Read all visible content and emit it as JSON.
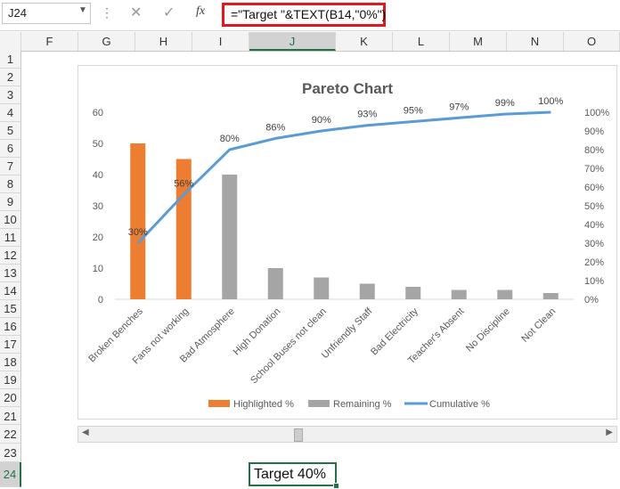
{
  "namebox": {
    "value": "J24"
  },
  "formula": {
    "value": "=\"Target \"&TEXT(B14,\"0%\")"
  },
  "icons": {
    "fx": "fx",
    "cancel": "✕",
    "enter": "✓",
    "dots": "⋮",
    "dropdown": "▼"
  },
  "columns": [
    "F",
    "G",
    "H",
    "I",
    "J",
    "K",
    "L",
    "M",
    "N",
    "O"
  ],
  "rows": [
    "1",
    "2",
    "3",
    "4",
    "5",
    "6",
    "7",
    "8",
    "9",
    "10",
    "11",
    "12",
    "13",
    "14",
    "15",
    "16",
    "17",
    "18",
    "19",
    "20",
    "21",
    "22",
    "23",
    "24"
  ],
  "selected": {
    "column": "J",
    "row": "24"
  },
  "active_cell": {
    "value": "Target 40%"
  },
  "chart_data": {
    "type": "bar",
    "title": "Pareto Chart",
    "categories": [
      "Broken Benches",
      "Fans not working",
      "Bad Atmosphere",
      "High Donation",
      "School Buses not clean",
      "Unfriendly Staff",
      "Bad Electricity",
      "Teacher's Absent",
      "No Discipline",
      "Not Clean"
    ],
    "series": [
      {
        "name": "Highlighted %",
        "kind": "bar",
        "color": "#ed7d31",
        "values": [
          50,
          45,
          0,
          0,
          0,
          0,
          0,
          0,
          0,
          0
        ]
      },
      {
        "name": "Remaining %",
        "kind": "bar",
        "color": "#a5a5a5",
        "values": [
          0,
          0,
          40,
          10,
          7,
          5,
          4,
          3,
          3,
          2
        ]
      },
      {
        "name": "Cumulative %",
        "kind": "line",
        "axis": "secondary",
        "color": "#5b9bd5",
        "values": [
          0.3,
          0.56,
          0.8,
          0.86,
          0.9,
          0.93,
          0.95,
          0.97,
          0.99,
          1.0
        ]
      }
    ],
    "line_labels": [
      "30%",
      "56%",
      "80%",
      "86%",
      "90%",
      "93%",
      "95%",
      "97%",
      "99%",
      "100%"
    ],
    "ylim": [
      0,
      60
    ],
    "y_ticks": [
      "0",
      "10",
      "20",
      "30",
      "40",
      "50",
      "60"
    ],
    "y2lim": [
      0,
      1
    ],
    "y2_ticks": [
      "0%",
      "10%",
      "20%",
      "30%",
      "40%",
      "50%",
      "60%",
      "70%",
      "80%",
      "90%",
      "100%"
    ],
    "legend_position": "bottom",
    "grid": false
  }
}
